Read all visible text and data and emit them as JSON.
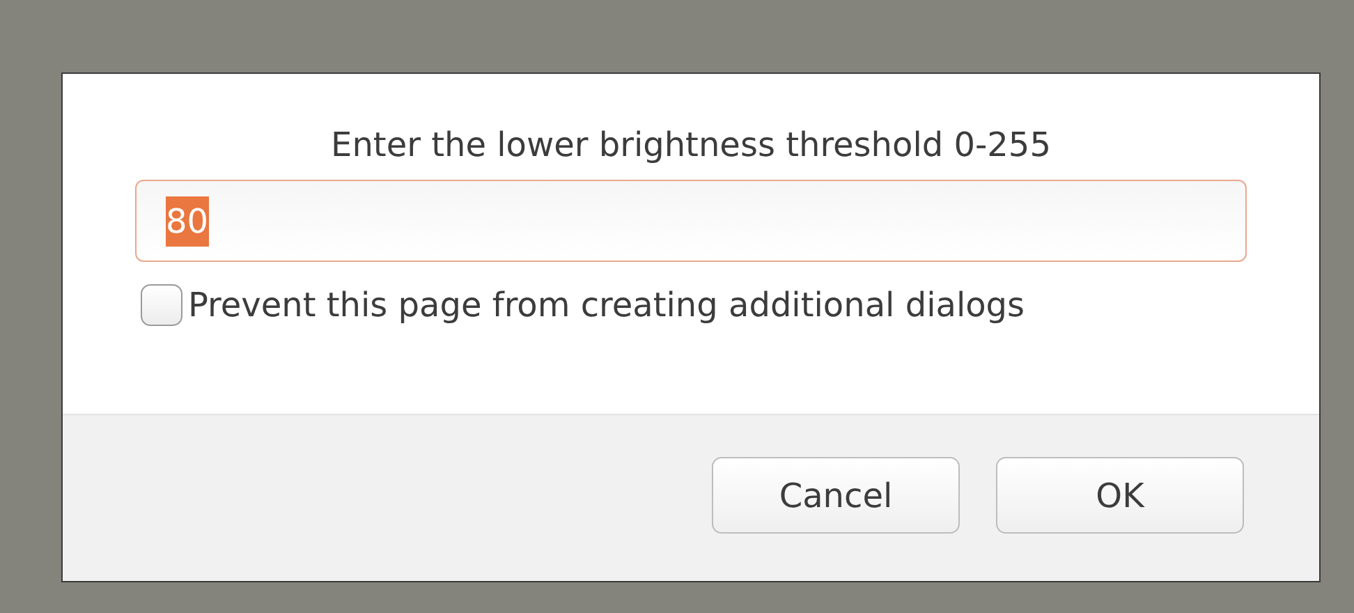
{
  "dialog": {
    "message": "Enter the lower brightness threshold 0-255",
    "input": {
      "value": "80",
      "value_selected": true
    },
    "checkbox": {
      "label": "Prevent this page from creating additional dialogs",
      "checked": false
    },
    "buttons": [
      {
        "label": "Cancel"
      },
      {
        "label": "OK"
      }
    ]
  }
}
